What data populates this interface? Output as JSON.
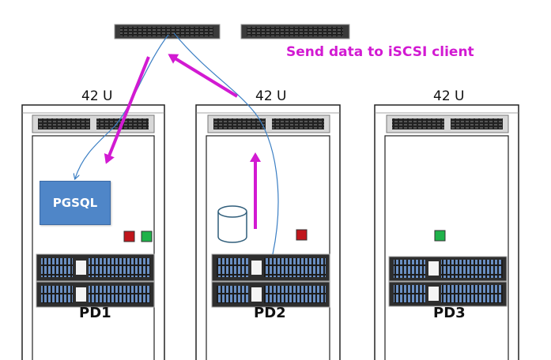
{
  "title": "Send data to iSCSI client",
  "racks": [
    {
      "id": "pd1",
      "units": "42 U",
      "label": "PD1"
    },
    {
      "id": "pd2",
      "units": "42 U",
      "label": "PD2"
    },
    {
      "id": "pd3",
      "units": "42 U",
      "label": "PD3"
    }
  ],
  "db_box": {
    "label": "PGSQL"
  },
  "colors": {
    "accent": "#d21ad2",
    "flow_line": "#3b7fc4",
    "status_red": "#c0161c",
    "status_green": "#1fb24a",
    "pgsql_fill": "#4f86c8"
  }
}
